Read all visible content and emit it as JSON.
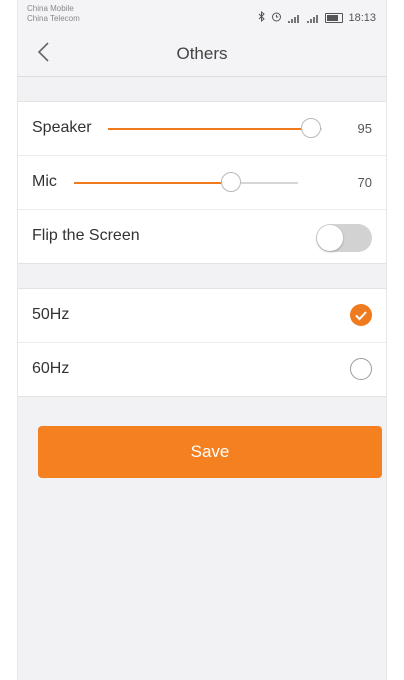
{
  "status_bar": {
    "carrier_1": "China Mobile",
    "carrier_2": "China Telecom",
    "time": "18:13"
  },
  "header": {
    "title": "Others"
  },
  "settings": {
    "speaker": {
      "label": "Speaker",
      "value": "95",
      "level": 0.95
    },
    "mic": {
      "label": "Mic",
      "value": "70",
      "level": 0.7
    },
    "flip": {
      "label": "Flip the Screen",
      "enabled": false
    }
  },
  "frequency": {
    "options": [
      {
        "label": "50Hz",
        "selected": true
      },
      {
        "label": "60Hz",
        "selected": false
      }
    ]
  },
  "save_label": "Save",
  "colors": {
    "accent": "#f5801f",
    "toggle_off": "#d2d2d2"
  }
}
